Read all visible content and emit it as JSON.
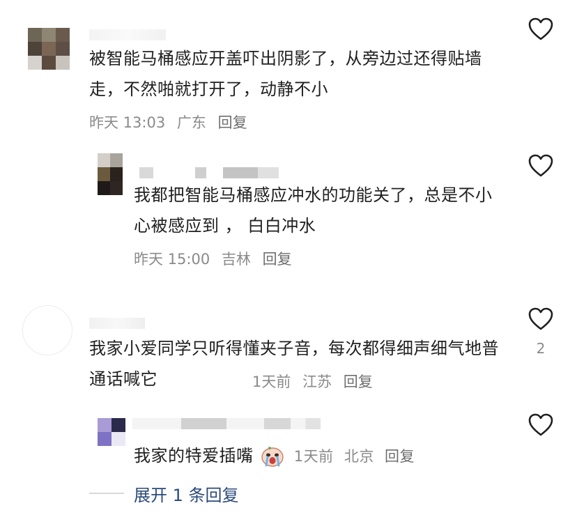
{
  "comments": [
    {
      "text": "被智能马桶感应开盖吓出阴影了，从旁边过还得贴墙走，不然啪就打开了，动静不小",
      "time": "昨天 13:03",
      "location": "广东",
      "reply_label": "回复"
    },
    {
      "text": "我都把智能马桶感应冲水的功能关了，总是不小心被感应到 ， 白白冲水",
      "time": "昨天 15:00",
      "location": "吉林",
      "reply_label": "回复"
    },
    {
      "text": "我家小爱同学只听得懂夹子音，每次都得细声细气地普通话喊它",
      "time": "1天前",
      "location": "江苏",
      "reply_label": "回复",
      "like_count": "2"
    },
    {
      "text": "我家的特爱插嘴",
      "time": "1天前",
      "location": "北京",
      "reply_label": "回复",
      "emoji": "crying-face"
    }
  ],
  "expand_replies": "展开 1 条回复",
  "icons": {
    "like": "heart-outline-icon"
  },
  "colors": {
    "meta": "#8a8a8a",
    "link": "#2b4a7a",
    "text": "#1f1f1f"
  }
}
